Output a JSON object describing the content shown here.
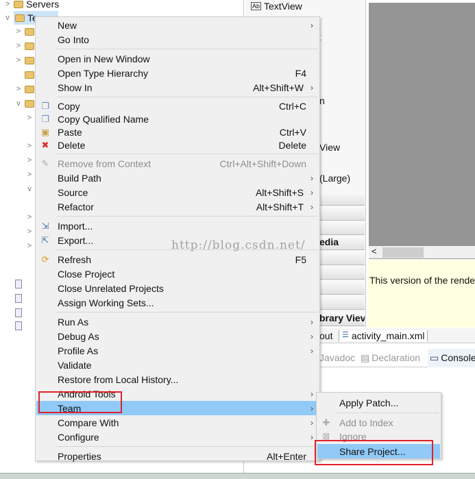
{
  "tree": {
    "items": [
      {
        "label": "Servers",
        "chevron": ">",
        "icon": "folder-icon"
      },
      {
        "label": "Te",
        "chevron": "v",
        "icon": "project-icon",
        "selected": true
      }
    ]
  },
  "palette": {
    "textview": "TextView",
    "labels": [
      "t",
      "n",
      "View",
      "(Large)",
      "edia",
      "brary Viev"
    ]
  },
  "editor": {
    "message": "This version of the rende",
    "tabs": [
      "out",
      "activity_main.xml"
    ],
    "bottom_tabs": [
      "Javadoc",
      "Declaration",
      "Console"
    ]
  },
  "watermark": "http://blog.csdn.net/",
  "context_menu": {
    "items": [
      {
        "label": "New",
        "submenu": true
      },
      {
        "label": "Go Into"
      },
      {
        "sep": true
      },
      {
        "label": "Open in New Window"
      },
      {
        "label": "Open Type Hierarchy",
        "shortcut": "F4"
      },
      {
        "label": "Show In",
        "shortcut": "Alt+Shift+W",
        "submenu": true
      },
      {
        "sep": true
      },
      {
        "label": "Copy",
        "shortcut": "Ctrl+C",
        "icon": "copy-icon"
      },
      {
        "label": "Copy Qualified Name",
        "icon": "copy-qualified-name-icon"
      },
      {
        "label": "Paste",
        "shortcut": "Ctrl+V",
        "icon": "paste-icon"
      },
      {
        "label": "Delete",
        "shortcut": "Delete",
        "icon": "delete-icon"
      },
      {
        "sep": true
      },
      {
        "label": "Remove from Context",
        "shortcut": "Ctrl+Alt+Shift+Down",
        "disabled": true,
        "icon": "remove-context-icon"
      },
      {
        "label": "Build Path",
        "submenu": true
      },
      {
        "label": "Source",
        "shortcut": "Alt+Shift+S",
        "submenu": true
      },
      {
        "label": "Refactor",
        "shortcut": "Alt+Shift+T",
        "submenu": true
      },
      {
        "sep": true
      },
      {
        "label": "Import...",
        "icon": "import-icon"
      },
      {
        "label": "Export...",
        "icon": "export-icon"
      },
      {
        "sep": true
      },
      {
        "label": "Refresh",
        "shortcut": "F5",
        "icon": "refresh-icon"
      },
      {
        "label": "Close Project"
      },
      {
        "label": "Close Unrelated Projects"
      },
      {
        "label": "Assign Working Sets..."
      },
      {
        "sep": true
      },
      {
        "label": "Run As",
        "submenu": true
      },
      {
        "label": "Debug As",
        "submenu": true
      },
      {
        "label": "Profile As",
        "submenu": true
      },
      {
        "label": "Validate"
      },
      {
        "label": "Restore from Local History..."
      },
      {
        "label": "Android Tools",
        "submenu": true
      },
      {
        "label": "Team",
        "submenu": true,
        "highlighted": true
      },
      {
        "label": "Compare With",
        "submenu": true
      },
      {
        "label": "Configure",
        "submenu": true
      },
      {
        "sep": true
      },
      {
        "label": "Properties",
        "shortcut": "Alt+Enter"
      }
    ]
  },
  "team_submenu": {
    "items": [
      {
        "label": "Apply Patch..."
      },
      {
        "sep": true
      },
      {
        "label": "Add to Index",
        "disabled": true,
        "icon": "add-to-index-icon"
      },
      {
        "label": "Ignore",
        "disabled": true,
        "icon": "ignore-icon"
      },
      {
        "label": "Share Project...",
        "highlighted": true
      }
    ]
  },
  "colors": {
    "highlight": "#91c9f7",
    "annotation": "#e0212a",
    "canvas": "#959595",
    "info": "#ffffe1"
  }
}
